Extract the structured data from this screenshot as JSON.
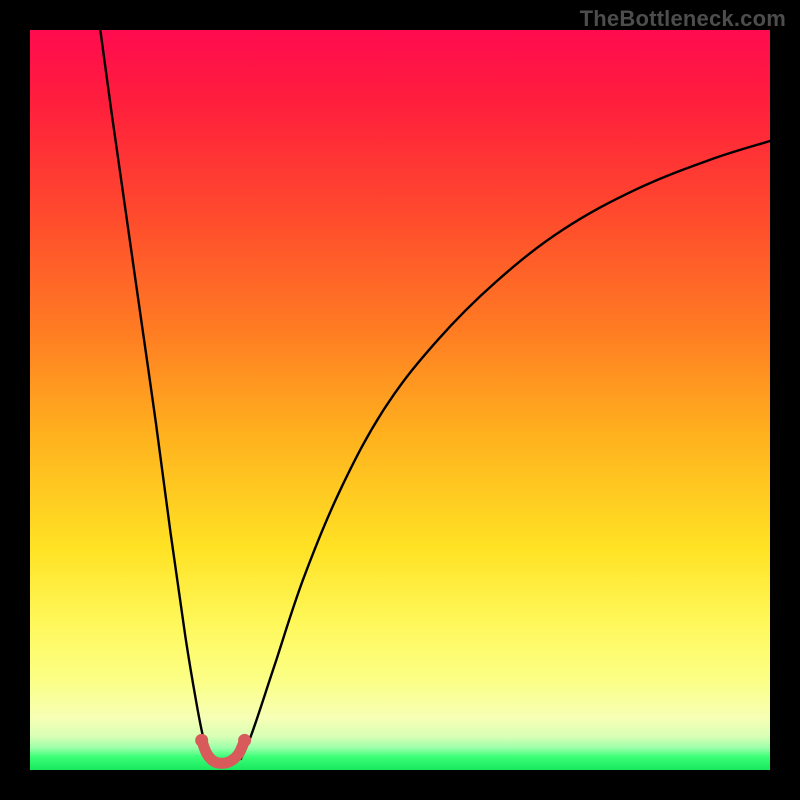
{
  "watermark": "TheBottleneck.com",
  "chart_data": {
    "type": "line",
    "title": "",
    "xlabel": "",
    "ylabel": "",
    "xlim": [
      0,
      100
    ],
    "ylim": [
      0,
      100
    ],
    "grid": false,
    "legend": false,
    "annotations": [],
    "series": [
      {
        "name": "left-branch",
        "color": "#000000",
        "x": [
          9.5,
          11,
          13,
          15,
          17,
          19,
          21,
          22.5,
          23.5,
          24.3
        ],
        "y": [
          100,
          89,
          75,
          61,
          47,
          32,
          18,
          9,
          4,
          1.5
        ]
      },
      {
        "name": "right-branch",
        "color": "#000000",
        "x": [
          28.5,
          30,
          33,
          37,
          42,
          48,
          55,
          63,
          72,
          82,
          92,
          100
        ],
        "y": [
          1.5,
          5,
          14,
          26,
          38,
          49,
          58,
          66,
          73,
          78.5,
          82.5,
          85
        ]
      },
      {
        "name": "trough-marker",
        "color": "#d85a5a",
        "x": [
          23.2,
          23.9,
          24.8,
          25.9,
          27.1,
          28.2,
          29.0
        ],
        "y": [
          4.0,
          2.2,
          1.2,
          0.9,
          1.2,
          2.2,
          4.0
        ]
      }
    ],
    "background_gradient": {
      "direction": "vertical",
      "stops": [
        {
          "pos": 0,
          "color": "#ff0b4f"
        },
        {
          "pos": 10,
          "color": "#ff1f3c"
        },
        {
          "pos": 25,
          "color": "#ff4a2d"
        },
        {
          "pos": 40,
          "color": "#ff7a23"
        },
        {
          "pos": 55,
          "color": "#ffb21e"
        },
        {
          "pos": 70,
          "color": "#ffe224"
        },
        {
          "pos": 80,
          "color": "#fff85a"
        },
        {
          "pos": 88,
          "color": "#fcff87"
        },
        {
          "pos": 93,
          "color": "#f6ffb5"
        },
        {
          "pos": 96,
          "color": "#d7ffb5"
        },
        {
          "pos": 97,
          "color": "#9cffaa"
        },
        {
          "pos": 98,
          "color": "#3cff78"
        },
        {
          "pos": 100,
          "color": "#18e85e"
        }
      ]
    }
  }
}
